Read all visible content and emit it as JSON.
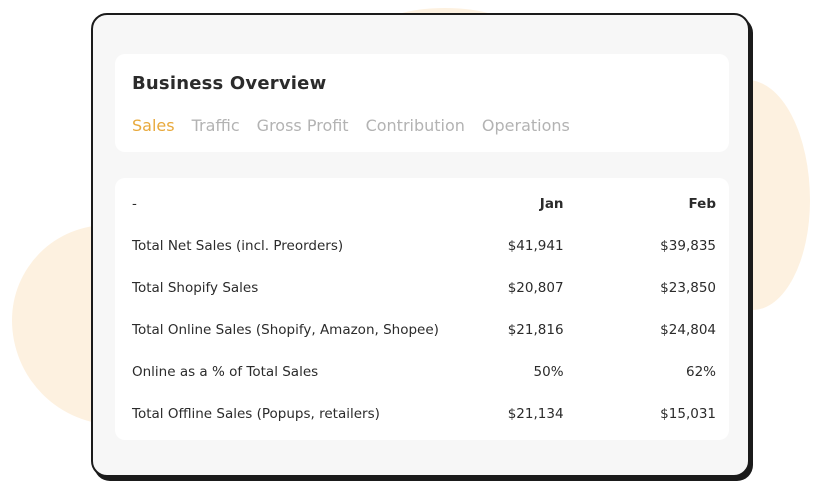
{
  "header": {
    "title": "Business Overview",
    "tabs": [
      {
        "label": "Sales",
        "active": true
      },
      {
        "label": "Traffic",
        "active": false
      },
      {
        "label": "Gross Profit",
        "active": false
      },
      {
        "label": "Contribution",
        "active": false
      },
      {
        "label": "Operations",
        "active": false
      }
    ]
  },
  "colors": {
    "active_tab": "#e8a93c",
    "inactive_tab": "#b3b3b3",
    "background_blob": "#fdf1e0"
  },
  "table": {
    "columns": [
      "-",
      "Jan",
      "Feb"
    ],
    "rows": [
      {
        "label": "Total Net Sales (incl. Preorders)",
        "jan": "$41,941",
        "feb": "$39,835"
      },
      {
        "label": "Total Shopify Sales",
        "jan": "$20,807",
        "feb": "$23,850"
      },
      {
        "label": "Total Online Sales (Shopify, Amazon, Shopee)",
        "jan": "$21,816",
        "feb": "$24,804"
      },
      {
        "label": "Online as a % of Total Sales",
        "jan": "50%",
        "feb": "62%"
      },
      {
        "label": "Total Offline Sales (Popups, retailers)",
        "jan": "$21,134",
        "feb": "$15,031"
      }
    ]
  }
}
